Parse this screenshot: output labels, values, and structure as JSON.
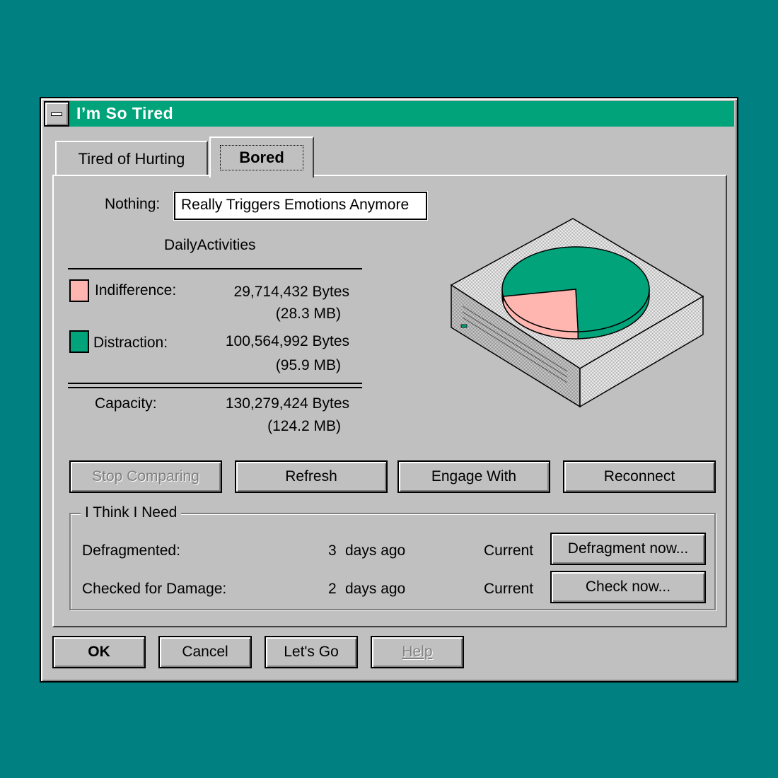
{
  "window": {
    "title": "I’m So Tired"
  },
  "tabs": [
    {
      "label": "Tired of Hurting",
      "active": false
    },
    {
      "label": "Bored",
      "active": true
    }
  ],
  "nothing": {
    "label": "Nothing:",
    "value": "Really Triggers Emotions Anymore"
  },
  "section_title": "DailyActivities",
  "usage": {
    "indifference": {
      "label": "Indifference:",
      "bytes": "29,714,432 Bytes",
      "mb": "(28.3 MB)",
      "color": "#ffb6b0"
    },
    "distraction": {
      "label": "Distraction:",
      "bytes": "100,564,992 Bytes",
      "mb": "(95.9 MB)",
      "color": "#00a37a"
    },
    "capacity": {
      "label": "Capacity:",
      "bytes": "130,279,424 Bytes",
      "mb": "(124.2 MB)"
    }
  },
  "pie": {
    "indifference_fraction": 0.228,
    "distraction_fraction": 0.772
  },
  "actions": [
    {
      "label": "Stop Comparing",
      "enabled": false
    },
    {
      "label": "Refresh",
      "enabled": true
    },
    {
      "label": "Engage With",
      "enabled": true
    },
    {
      "label": "Reconnect",
      "enabled": true
    }
  ],
  "group": {
    "label": "I Think I Need",
    "rows": [
      {
        "label": "Defragmented:",
        "count": "3",
        "unit": "days ago",
        "status": "Current",
        "button": "Defragment now..."
      },
      {
        "label": "Checked for Damage:",
        "count": "2",
        "unit": "days ago",
        "status": "Current",
        "button": "Check now..."
      }
    ]
  },
  "footer": {
    "ok": "OK",
    "cancel": "Cancel",
    "lets_go": "Let's Go",
    "help": "Help"
  }
}
